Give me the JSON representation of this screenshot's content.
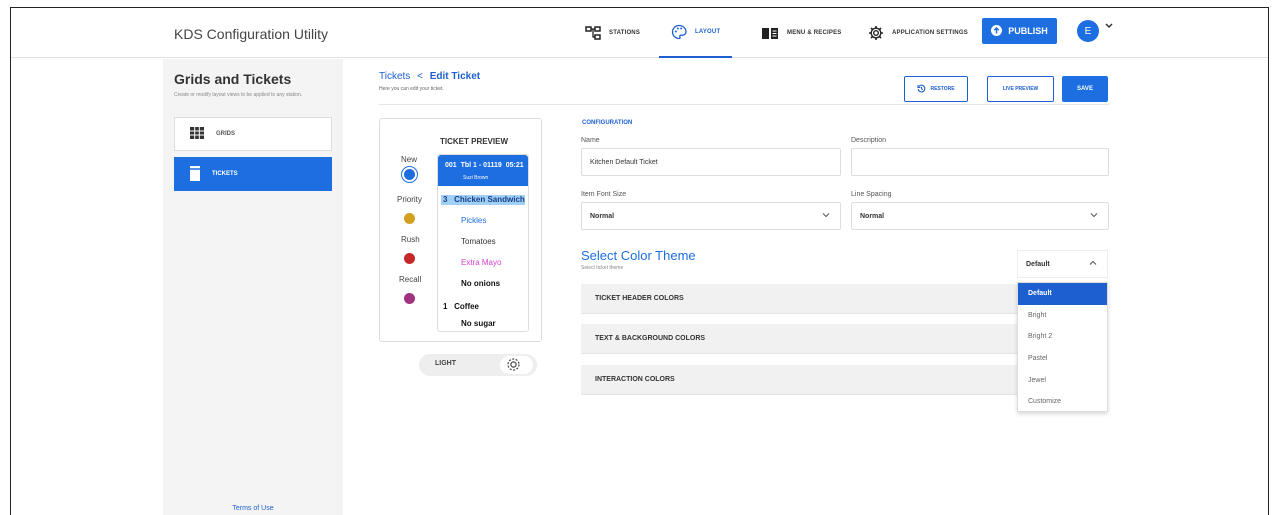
{
  "header": {
    "app_title": "KDS Configuration Utility",
    "nav": [
      {
        "label": "STATIONS",
        "icon": "stations-icon"
      },
      {
        "label": "LAYOUT",
        "icon": "palette-icon",
        "active": true
      },
      {
        "label": "MENU & RECIPES",
        "icon": "book-icon"
      },
      {
        "label": "APPLICATION SETTINGS",
        "icon": "gear-icon"
      }
    ],
    "publish_label": "PUBLISH",
    "avatar_initial": "E"
  },
  "sidebar": {
    "title": "Grids and Tickets",
    "subtitle": "Create or modify layout views to be applied to any station.",
    "items": [
      {
        "label": "GRIDS",
        "icon": "grid-icon",
        "active": false
      },
      {
        "label": "TICKETS",
        "icon": "ticket-icon",
        "active": true
      }
    ],
    "terms_label": "Terms of Use"
  },
  "page": {
    "breadcrumb_parent": "Tickets",
    "breadcrumb_separator": "<",
    "breadcrumb_current": "Edit Ticket",
    "subtitle": "Here you can edit your ticket.",
    "restore_label": "RESTORE",
    "live_preview_label": "LIVE PREVIEW",
    "save_label": "SAVE"
  },
  "preview": {
    "title": "TICKET PREVIEW",
    "legend": [
      {
        "label": "New",
        "color": "#1d6ee0"
      },
      {
        "label": "Priority",
        "color": "#d4a020"
      },
      {
        "label": "Rush",
        "color": "#c62828"
      },
      {
        "label": "Recall",
        "color": "#a0327f"
      }
    ],
    "ticket": {
      "header_line": "001  Tbl 1 - 01119  05:21",
      "server": "Suzi Brown",
      "lines": [
        {
          "text": "3   Chicken Sandwich",
          "color": "#1a3d8a",
          "bold": true
        },
        {
          "text": "Pickles",
          "color": "#1d6ee0",
          "bold": false
        },
        {
          "text": "Tomatoes",
          "color": "#333333",
          "bold": false
        },
        {
          "text": "Extra Mayo",
          "color": "#d040d0",
          "bold": false
        },
        {
          "text": "No onions",
          "color": "#111111",
          "bold": true
        },
        {
          "text": "1   Coffee",
          "color": "#111111",
          "bold": true
        },
        {
          "text": "No sugar",
          "color": "#111111",
          "bold": true
        }
      ]
    },
    "theme_toggle_label": "LIGHT"
  },
  "configuration": {
    "heading": "CONFIGURATION",
    "name_label": "Name",
    "name_value": "Kitchen Default Ticket",
    "description_label": "Description",
    "description_value": "",
    "font_size_label": "Item Font Size",
    "font_size_value": "Normal",
    "line_spacing_label": "Line Spacing",
    "line_spacing_value": "Normal"
  },
  "color_theme": {
    "title": "Select Color Theme",
    "subtitle": "Select ticket theme",
    "selected": "Default",
    "options": [
      "Default",
      "Bright",
      "Bright 2",
      "Pastel",
      "Jewel",
      "Customize"
    ],
    "sections": [
      "TICKET HEADER COLORS",
      "TEXT & BACKGROUND COLORS",
      "INTERACTION COLORS"
    ]
  },
  "colors": {
    "accent": "#1d6ee0",
    "highlight": "#9fd0f6"
  }
}
